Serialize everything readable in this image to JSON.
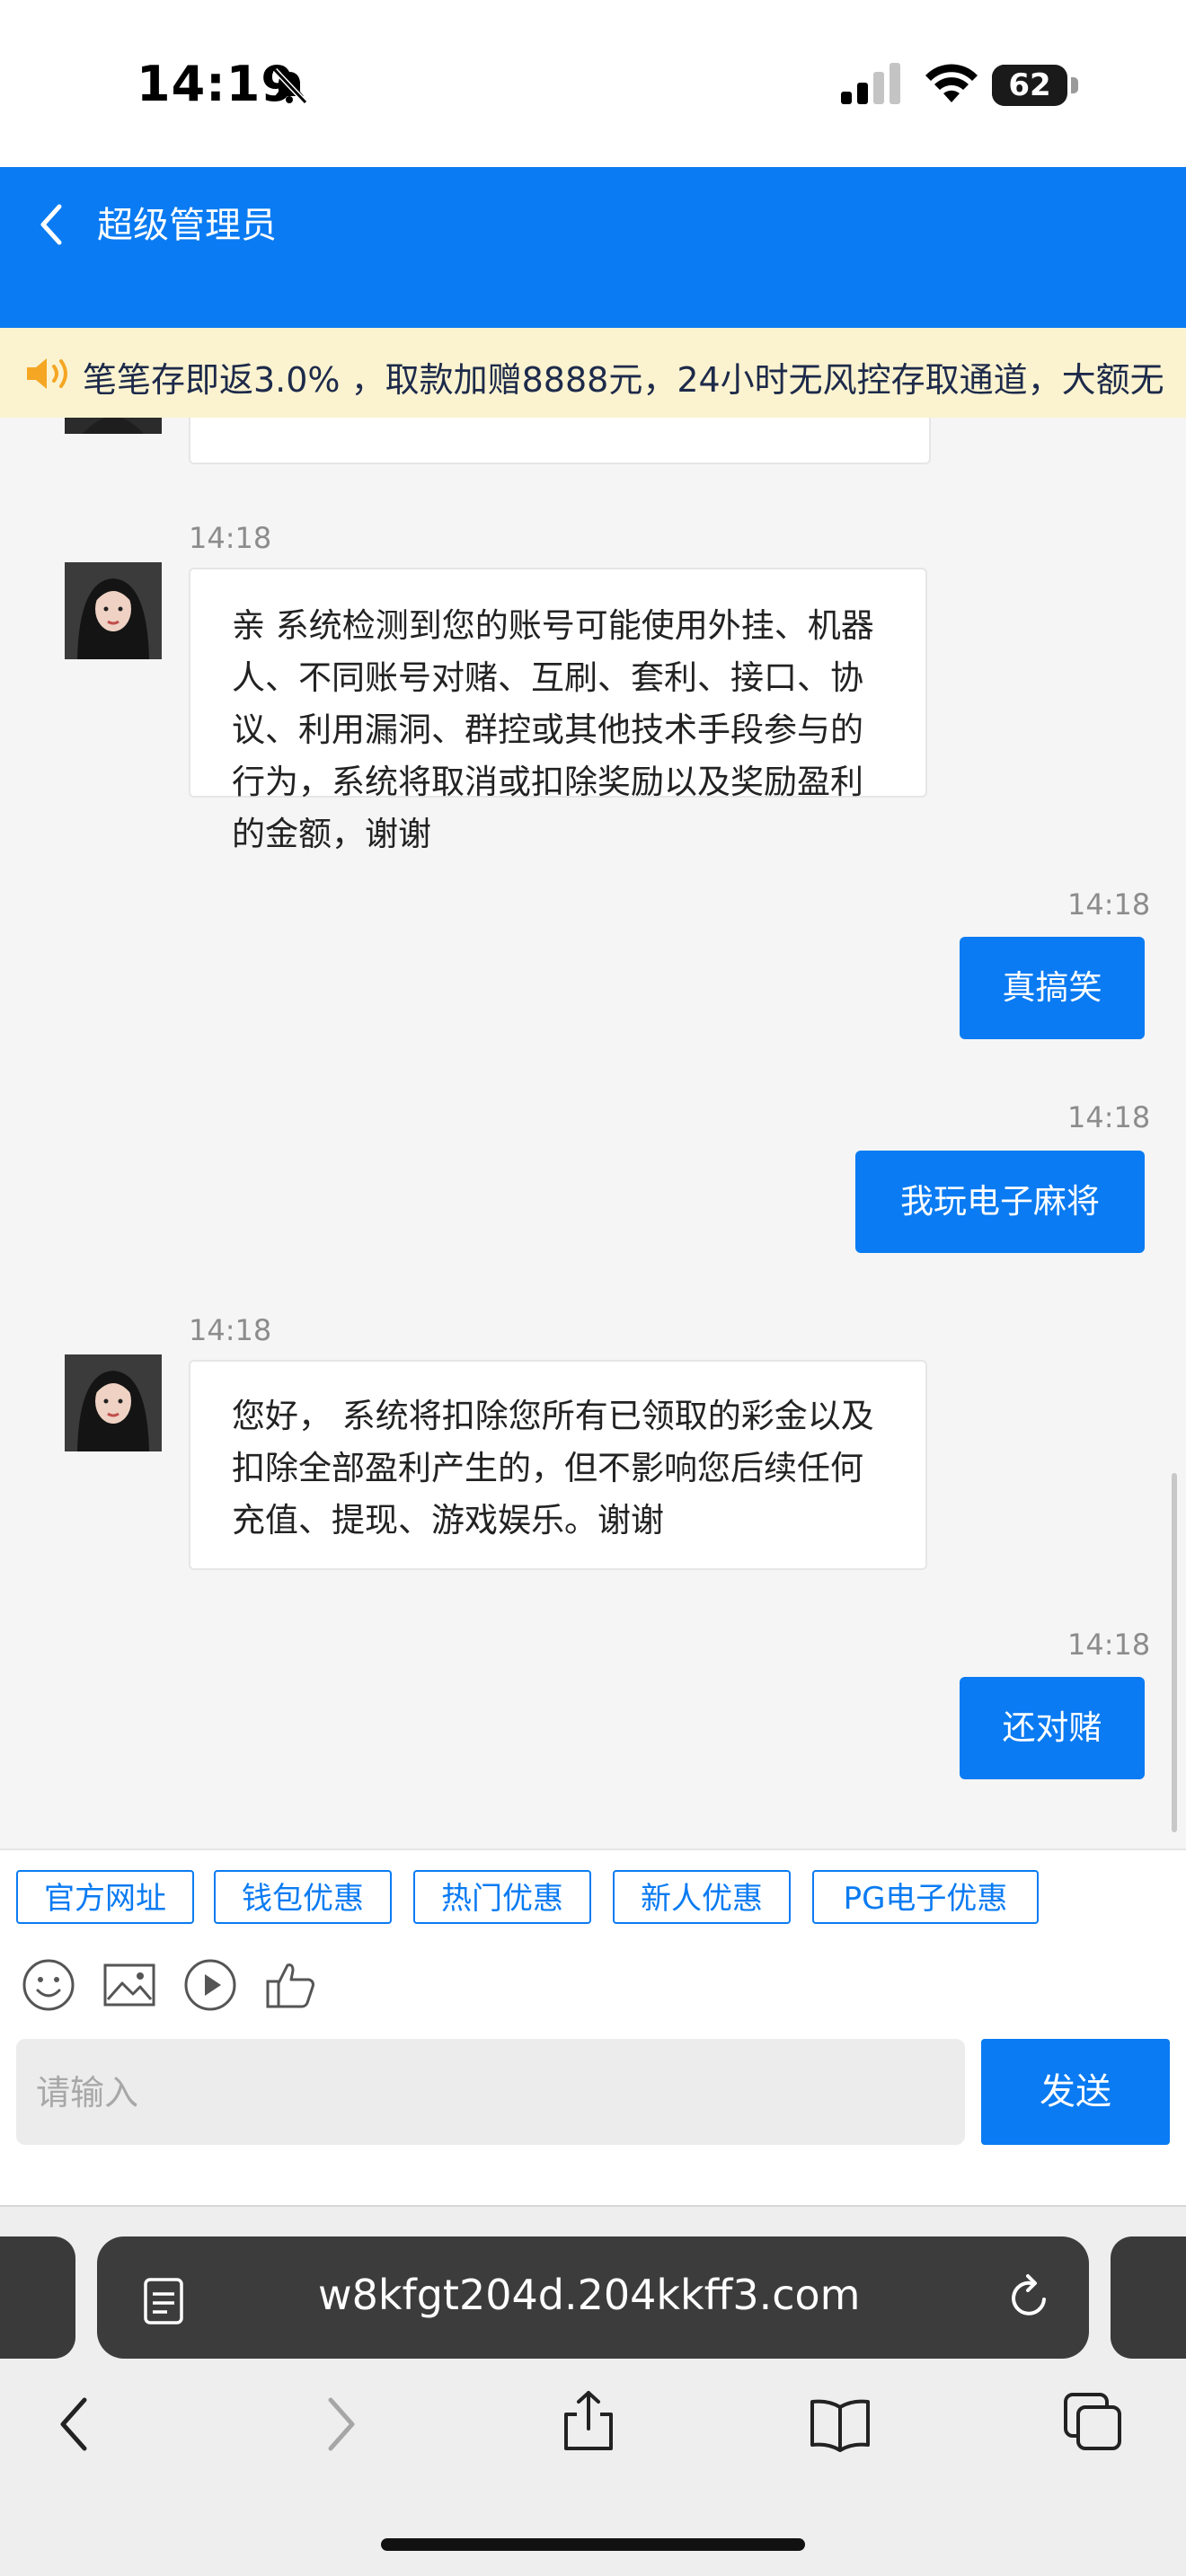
{
  "status_bar": {
    "time": "14:19",
    "battery": "62",
    "battery_level_percent": 62
  },
  "header": {
    "title": "超级管理员"
  },
  "notice": {
    "text": "笔笔存即返3.0% ，取款加赠8888元，24小时无风控存取通道，大额无"
  },
  "messages": [
    {
      "side": "left",
      "time": "14:18",
      "text": "亲 系统检测到您的账号可能使用外挂、机器人、不同账号对赌、互刷、套利、接口、协议、利用漏洞、群控或其他技术手段参与的行为，系统将取消或扣除奖励以及奖励盈利的金额，谢谢"
    },
    {
      "side": "right",
      "time": "14:18",
      "text": "真搞笑"
    },
    {
      "side": "right",
      "time": "14:18",
      "text": "我玩电子麻将"
    },
    {
      "side": "left",
      "time": "14:18",
      "text": "您好， 系统将扣除您所有已领取的彩金以及扣除全部盈利产生的，但不影响您后续任何充值、提现、游戏娱乐。谢谢"
    },
    {
      "side": "right",
      "time": "14:18",
      "text": "还对赌"
    }
  ],
  "quick_tags": [
    "官方网址",
    "钱包优惠",
    "热门优惠",
    "新人优惠",
    "PG电子优惠"
  ],
  "tools": [
    "emoji-icon",
    "image-icon",
    "video-icon",
    "thumbs-up-icon"
  ],
  "input": {
    "placeholder": "请输入",
    "value": ""
  },
  "send_label": "发送",
  "browser": {
    "url": "w8kfgt204d.204kkff3.com"
  },
  "colors": {
    "accent": "#0a7bf2",
    "notice_bg": "#fbf3d0",
    "page_bg": "#f5f5f5"
  }
}
